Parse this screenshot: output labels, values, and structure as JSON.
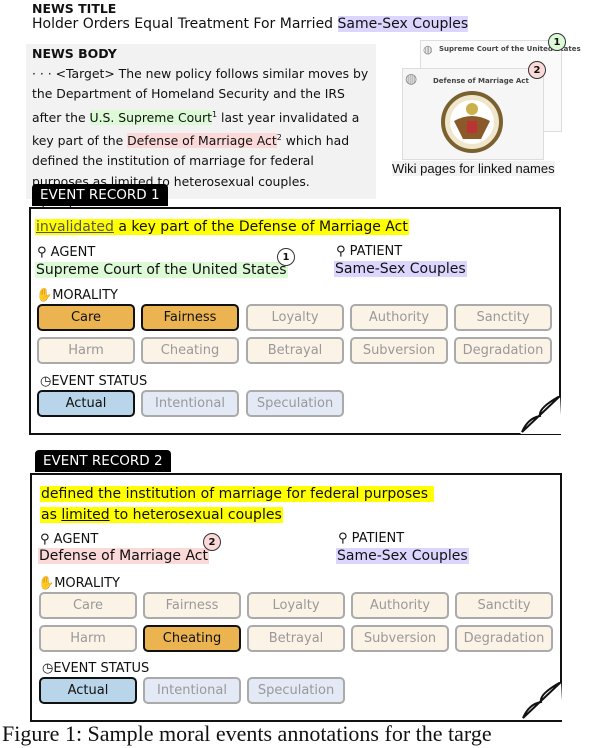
{
  "news_title": {
    "label": "NEWS TITLE",
    "text_before": "Holder Orders Equal Treatment For Married ",
    "text_highlight": "Same-Sex Couples"
  },
  "news_body": {
    "label": "NEWS BODY",
    "t1": "· · · <Target> The new policy follows similar moves by the Department of Homeland Security and the IRS after the ",
    "e1": "U.S. Supreme Court",
    "m1": "1",
    "t2": " last year invalidated a key part of the ",
    "e2": "Defense of Marriage Act",
    "m2": "2",
    "t3": " which had defined the institution of marriage for federal purposes as limited to heterosexual couples.  </Target> · · ·"
  },
  "wiki": {
    "page1": "Supreme Court of the United States",
    "page2": "Defense of Marriage Act",
    "badge1": "1",
    "badge2": "2",
    "caption": "Wiki pages for linked names"
  },
  "records": [
    {
      "tab": "EVENT RECORD 1",
      "trigger": "invalidated",
      "sentence_rest": " a key part of the Defense of Marriage Act",
      "agent_label": "AGENT",
      "agent": "Supreme Court of the United States",
      "agent_badge": "1",
      "patient_label": "PATIENT",
      "patient": "Same-Sex Couples",
      "morality_label": "MORALITY",
      "morality": [
        {
          "label": "Care",
          "selected": true
        },
        {
          "label": "Fairness",
          "selected": true
        },
        {
          "label": "Loyalty",
          "selected": false
        },
        {
          "label": "Authority",
          "selected": false
        },
        {
          "label": "Sanctity",
          "selected": false
        },
        {
          "label": "Harm",
          "selected": false
        },
        {
          "label": "Cheating",
          "selected": false
        },
        {
          "label": "Betrayal",
          "selected": false
        },
        {
          "label": "Subversion",
          "selected": false
        },
        {
          "label": "Degradation",
          "selected": false
        }
      ],
      "status_label": "EVENT STATUS",
      "status": [
        {
          "label": "Actual",
          "selected": true
        },
        {
          "label": "Intentional",
          "selected": false
        },
        {
          "label": "Speculation",
          "selected": false
        }
      ]
    },
    {
      "tab": "EVENT RECORD 2",
      "sentence_pre": "defined the institution of marriage for federal purposes",
      "sentence_as": "as ",
      "trigger": "limited",
      "sentence_rest": " to heterosexual couples",
      "agent_label": "AGENT",
      "agent": "Defense of Marriage Act",
      "agent_badge": "2",
      "patient_label": "PATIENT",
      "patient": "Same-Sex Couples",
      "morality_label": "MORALITY",
      "morality": [
        {
          "label": "Care",
          "selected": false
        },
        {
          "label": "Fairness",
          "selected": false
        },
        {
          "label": "Loyalty",
          "selected": false
        },
        {
          "label": "Authority",
          "selected": false
        },
        {
          "label": "Sanctity",
          "selected": false
        },
        {
          "label": "Harm",
          "selected": false
        },
        {
          "label": "Cheating",
          "selected": true
        },
        {
          "label": "Betrayal",
          "selected": false
        },
        {
          "label": "Subversion",
          "selected": false
        },
        {
          "label": "Degradation",
          "selected": false
        }
      ],
      "status_label": "EVENT STATUS",
      "status": [
        {
          "label": "Actual",
          "selected": true
        },
        {
          "label": "Intentional",
          "selected": false
        },
        {
          "label": "Speculation",
          "selected": false
        }
      ]
    }
  ],
  "caption": "Figure 1: Sample moral events annotations for the targe",
  "colors": {
    "selected_morality": "#ebb450",
    "unselected_morality": "#fbf3e6",
    "selected_status": "#b8d5ea",
    "unselected_status": "#e3e9f5",
    "trigger": "#ffff00",
    "agent1": "#dcfad6",
    "agent2": "#fbd9d9",
    "patient": "#dcd6ff"
  }
}
